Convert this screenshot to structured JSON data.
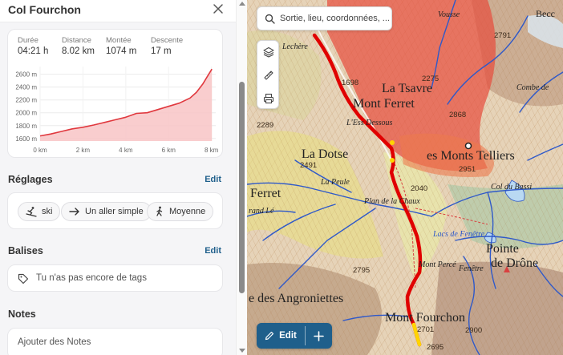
{
  "panel": {
    "title": "Col Fourchon",
    "stats": [
      {
        "label": "Durée",
        "value": "04:21 h"
      },
      {
        "label": "Distance",
        "value": "8.02 km"
      },
      {
        "label": "Montée",
        "value": "1074 m"
      },
      {
        "label": "Descente",
        "value": "17 m"
      }
    ],
    "settings": {
      "title": "Réglages",
      "edit_label": "Edit",
      "chips": [
        {
          "label": "ski",
          "icon": "ski-icon"
        },
        {
          "label": "Un aller simple",
          "icon": "arrow-right-icon"
        },
        {
          "label": "Moyenne",
          "icon": "hiker-icon"
        }
      ]
    },
    "tags": {
      "title": "Balises",
      "edit_label": "Edit",
      "placeholder": "Tu n'as pas encore de tags"
    },
    "notes": {
      "title": "Notes",
      "placeholder": "Ajouter des Notes"
    }
  },
  "chart_data": {
    "type": "area",
    "title": "",
    "xlabel": "",
    "ylabel": "",
    "x_ticks": [
      "0 km",
      "2 km",
      "4 km",
      "6 km",
      "8 km"
    ],
    "y_ticks": [
      "1600 m",
      "1800 m",
      "2000 m",
      "2200 m",
      "2400 m",
      "2600 m"
    ],
    "xlim": [
      0,
      8.2
    ],
    "ylim": [
      1560,
      2720
    ],
    "x": [
      0,
      0.5,
      1,
      1.5,
      2,
      2.5,
      3,
      3.5,
      4,
      4.5,
      5,
      5.5,
      6,
      6.5,
      7,
      7.3,
      7.6,
      7.8,
      8.02
    ],
    "y": [
      1640,
      1670,
      1710,
      1750,
      1775,
      1810,
      1850,
      1890,
      1930,
      1990,
      2000,
      2050,
      2100,
      2150,
      2230,
      2320,
      2450,
      2560,
      2680
    ],
    "line_color": "#e0383e",
    "fill_color": "#f8c4c6",
    "grid": true
  },
  "map": {
    "search_placeholder": "Sortie, lieu, coordonnées, ...",
    "edit_label": "Edit",
    "labels": [
      {
        "text": "Vousse",
        "cls": "small"
      },
      {
        "text": "Becc",
        "cls": "med"
      },
      {
        "text": "2791",
        "cls": "num"
      },
      {
        "text": "Lechère",
        "cls": "small"
      },
      {
        "text": "1698",
        "cls": "num"
      },
      {
        "text": "La Tsavre",
        "cls": "big"
      },
      {
        "text": "Mont Ferret",
        "cls": "big"
      },
      {
        "text": "2275",
        "cls": "num"
      },
      {
        "text": "2868",
        "cls": "num"
      },
      {
        "text": "Combe de",
        "cls": "small"
      },
      {
        "text": "L'Ess Dessous",
        "cls": "small"
      },
      {
        "text": "La Dotse",
        "cls": "big"
      },
      {
        "text": "2491",
        "cls": "num"
      },
      {
        "text": "es Monts Telliers",
        "cls": "big"
      },
      {
        "text": "2951",
        "cls": "num"
      },
      {
        "text": "Col du Bassi",
        "cls": "small"
      },
      {
        "text": "Ferret",
        "cls": "big"
      },
      {
        "text": "La Peule",
        "cls": "small"
      },
      {
        "text": "2040",
        "cls": "num"
      },
      {
        "text": "Plan de la Chaux",
        "cls": "small"
      },
      {
        "text": "2289",
        "cls": "num"
      },
      {
        "text": "rand Lé",
        "cls": "small"
      },
      {
        "text": "Lacs de Fenêtre",
        "cls": "water"
      },
      {
        "text": "Mont Percé",
        "cls": "small"
      },
      {
        "text": "Pointe",
        "cls": "big"
      },
      {
        "text": "de Drône",
        "cls": "big"
      },
      {
        "text": "Fenêtre",
        "cls": "small"
      },
      {
        "text": "2795",
        "cls": "num"
      },
      {
        "text": "e des Angroniettes",
        "cls": "big"
      },
      {
        "text": "Mont Fourchon",
        "cls": "big"
      },
      {
        "text": "2695",
        "cls": "num"
      },
      {
        "text": "2900",
        "cls": "num"
      },
      {
        "text": "2701",
        "cls": "num"
      }
    ]
  }
}
